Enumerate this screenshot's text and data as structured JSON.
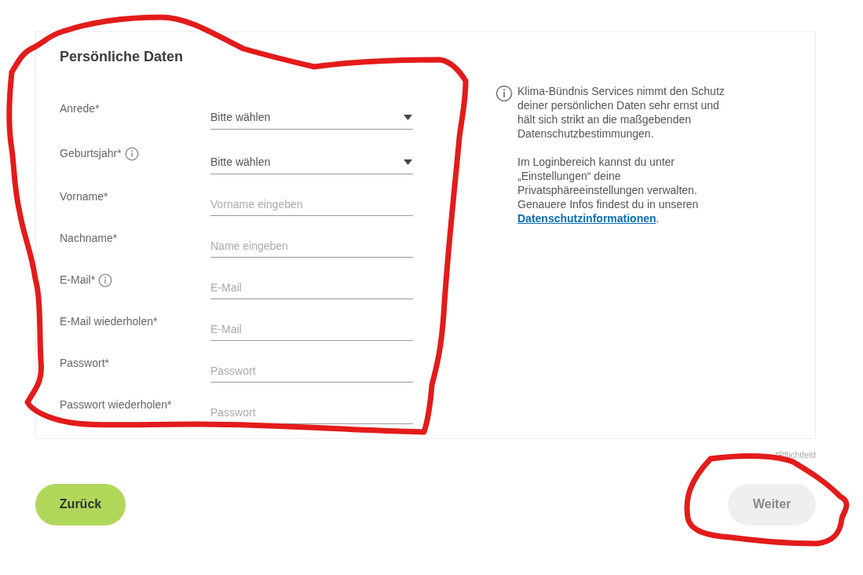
{
  "form": {
    "title": "Persönliche Daten",
    "fields": [
      {
        "label": "Anrede*",
        "kind": "select",
        "value": "Bitte wählen",
        "info": false
      },
      {
        "label": "Geburtsjahr*",
        "kind": "select",
        "value": "Bitte wählen",
        "info": true
      },
      {
        "label": "Vorname*",
        "kind": "input",
        "placeholder": "Vorname eingeben",
        "info": false
      },
      {
        "label": "Nachname*",
        "kind": "input",
        "placeholder": "Name eingeben",
        "info": false
      },
      {
        "label": "E-Mail*",
        "kind": "input",
        "placeholder": "E-Mail",
        "info": true
      },
      {
        "label": "E-Mail wiederholen*",
        "kind": "input",
        "placeholder": "E-Mail",
        "info": false
      },
      {
        "label": "Passwort*",
        "kind": "input",
        "placeholder": "Passwort",
        "info": false
      },
      {
        "label": "Passwort wiederholen*",
        "kind": "input",
        "placeholder": "Passwort",
        "info": false
      }
    ]
  },
  "privacy_note": {
    "paragraphs": [
      {
        "text": "Klima-Bündnis Services nimmt den Schutz deiner persönlichen Daten sehr ernst und hält sich strikt an die maßgebenden Datenschutzbestimmungen."
      },
      {
        "text": "Im Loginbereich kannst du unter „Einstellungen“ deine Privatsphäreeinstellungen verwalten. Genauere Infos findest du in unseren ",
        "link": "Datenschutzinformationen",
        "after": "."
      }
    ]
  },
  "required_note": "*Pflichtfeld",
  "buttons": [
    {
      "label": "Zurück",
      "kind": "back",
      "disabled": false
    },
    {
      "label": "Weiter",
      "kind": "next",
      "disabled": true
    }
  ]
}
